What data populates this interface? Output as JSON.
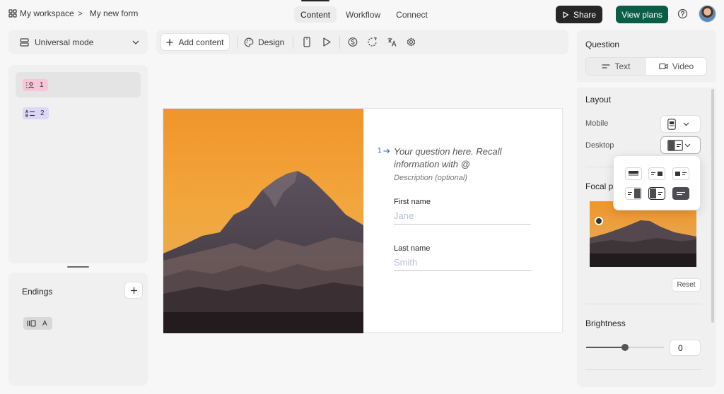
{
  "breadcrumb": {
    "workspace": "My workspace",
    "separator": ">",
    "form": "My new form"
  },
  "tabs": [
    {
      "label": "Content"
    },
    {
      "label": "Workflow"
    },
    {
      "label": "Connect"
    }
  ],
  "header": {
    "share_label": "Share",
    "plans_label": "View plans"
  },
  "left": {
    "mode_label": "Universal mode",
    "questions": [
      {
        "number": "1",
        "icon": "contact-icon"
      },
      {
        "number": "2",
        "icon": "text-list-icon"
      }
    ],
    "endings_title": "Endings",
    "ending_badge": "A"
  },
  "toolbar": {
    "add_content_label": "Add content",
    "design_label": "Design"
  },
  "question": {
    "number": "1",
    "title": "Your question here. Recall information with @",
    "description": "Description (optional)",
    "fields": [
      {
        "label": "First name",
        "placeholder": "Jane"
      },
      {
        "label": "Last name",
        "placeholder": "Smith"
      }
    ]
  },
  "right": {
    "question_title": "Question",
    "segments": [
      {
        "label": "Text"
      },
      {
        "label": "Video"
      }
    ],
    "layout_title": "Layout",
    "mobile_label": "Mobile",
    "desktop_label": "Desktop",
    "focal_label": "Focal po",
    "reset_label": "Reset",
    "brightness_title": "Brightness",
    "brightness_value": "0",
    "brightness_level": 0.5
  },
  "colors": {
    "share_bg": "#262627",
    "plans_bg": "#0b5e46",
    "question_accent": "#2d62d9"
  }
}
